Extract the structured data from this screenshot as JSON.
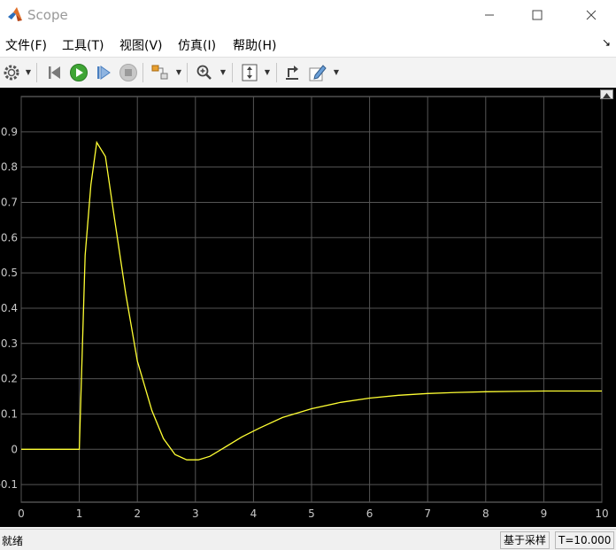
{
  "window": {
    "title": "Scope"
  },
  "menu": [
    "文件(F)",
    "工具(T)",
    "视图(V)",
    "仿真(I)",
    "帮助(H)"
  ],
  "toolbar": {
    "icons": [
      "gear-icon",
      "step-back-icon",
      "run-icon",
      "step-forward-icon",
      "stop-icon",
      "highlight-icon",
      "zoom-in-icon",
      "autoscale-icon",
      "restore-icon",
      "edit-icon"
    ]
  },
  "status": {
    "left": "就绪",
    "mode": "基于采样",
    "time": "T=10.000"
  },
  "colors": {
    "plot_bg": "#000000",
    "signal": "#ffff33",
    "grid": "#555555",
    "tick_text": "#c8c8c8"
  },
  "chart_data": {
    "type": "line",
    "title": "",
    "xlabel": "",
    "ylabel": "",
    "xlim": [
      0,
      10
    ],
    "ylim": [
      -0.15,
      1.0
    ],
    "xticks": [
      "0",
      "1",
      "2",
      "3",
      "4",
      "5",
      "6",
      "7",
      "8",
      "9",
      "10"
    ],
    "yticks": [
      "-0.1",
      "0",
      "0.1",
      "0.2",
      "0.3",
      "0.4",
      "0.5",
      "0.6",
      "0.7",
      "0.8",
      "0.9"
    ],
    "grid": true,
    "series": [
      {
        "x": [
          0,
          1.0,
          1.1,
          1.2,
          1.3,
          1.45,
          1.6,
          1.8,
          2.0,
          2.25,
          2.45,
          2.65,
          2.85,
          3.05,
          3.25,
          3.5,
          3.8,
          4.1,
          4.5,
          5.0,
          5.5,
          6.0,
          6.5,
          7.0,
          7.5,
          8.0,
          8.5,
          9.0,
          9.5,
          10.0
        ],
        "y": [
          0,
          0,
          0.55,
          0.75,
          0.87,
          0.83,
          0.66,
          0.44,
          0.25,
          0.11,
          0.03,
          -0.015,
          -0.03,
          -0.03,
          -0.02,
          0.005,
          0.035,
          0.06,
          0.09,
          0.115,
          0.133,
          0.145,
          0.153,
          0.158,
          0.161,
          0.163,
          0.164,
          0.165,
          0.165,
          0.165
        ]
      }
    ]
  }
}
